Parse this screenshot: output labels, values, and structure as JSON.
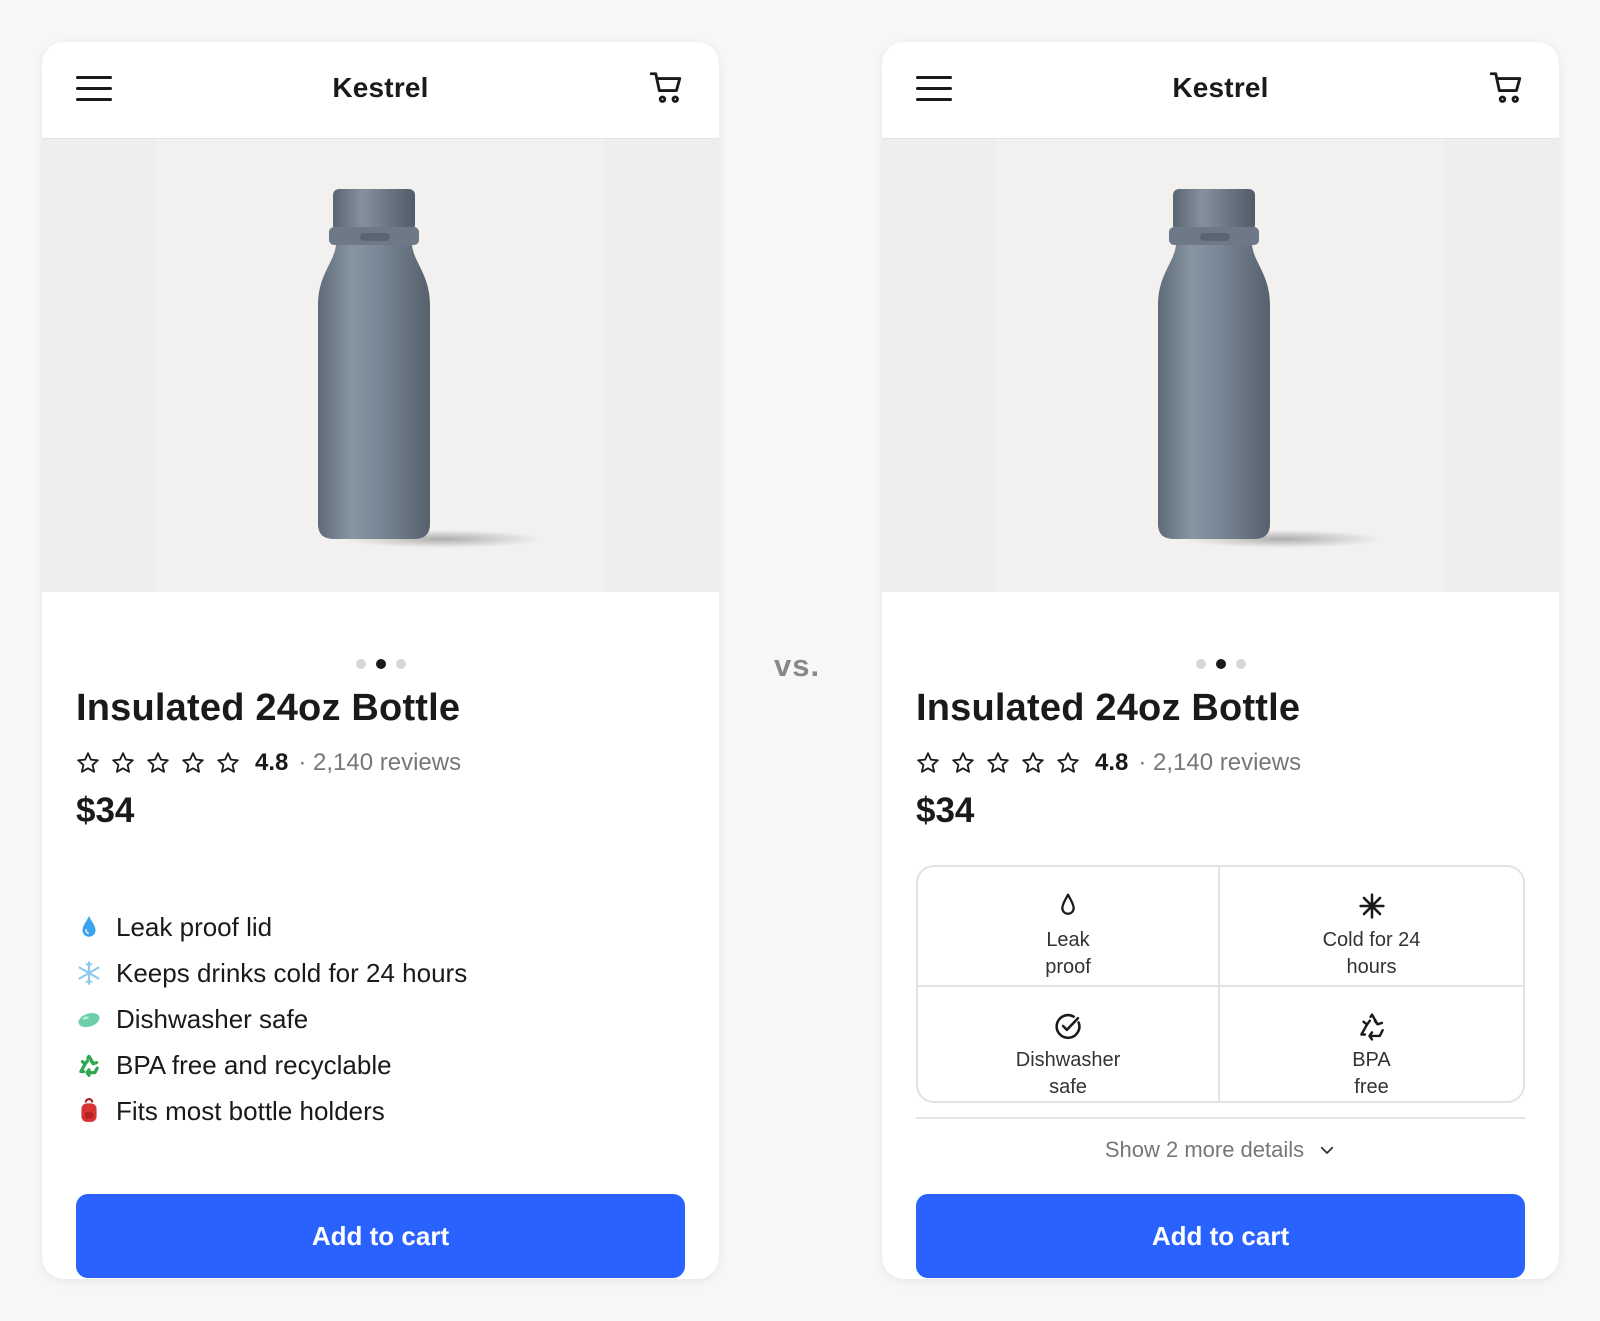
{
  "comparison_label": "vs.",
  "header": {
    "brand": "Kestrel"
  },
  "product": {
    "title": "Insulated 24oz Bottle",
    "stars": 5,
    "rating": "4.8",
    "reviews": "· 2,140 reviews",
    "price": "$34",
    "carousel": {
      "total": 3,
      "active_index": 1
    }
  },
  "variant_a": {
    "features": [
      {
        "icon": "water-drop-icon",
        "text": "Leak proof lid"
      },
      {
        "icon": "snowflake-icon",
        "text": "Keeps drinks cold for 24 hours"
      },
      {
        "icon": "soap-icon",
        "text": "Dishwasher safe"
      },
      {
        "icon": "recycle-icon",
        "text": "BPA free and recyclable"
      },
      {
        "icon": "backpack-icon",
        "text": "Fits most bottle holders"
      }
    ],
    "cta_label": "Add to cart"
  },
  "variant_b": {
    "features": [
      {
        "icon": "drop-icon",
        "line1": "Leak",
        "line2": "proof"
      },
      {
        "icon": "asterisk-icon",
        "line1": "Cold for 24",
        "line2": "hours"
      },
      {
        "icon": "check-circle-icon",
        "line1": "Dishwasher",
        "line2": "safe"
      },
      {
        "icon": "recycle-icon",
        "line1": "BPA",
        "line2": "free"
      }
    ],
    "show_more_label": "Show 2 more details",
    "cta_label": "Add to cart"
  },
  "colors": {
    "cta": "#2962ff",
    "bottle": "#768391",
    "text": "#1a1a1a",
    "muted": "#777777"
  }
}
